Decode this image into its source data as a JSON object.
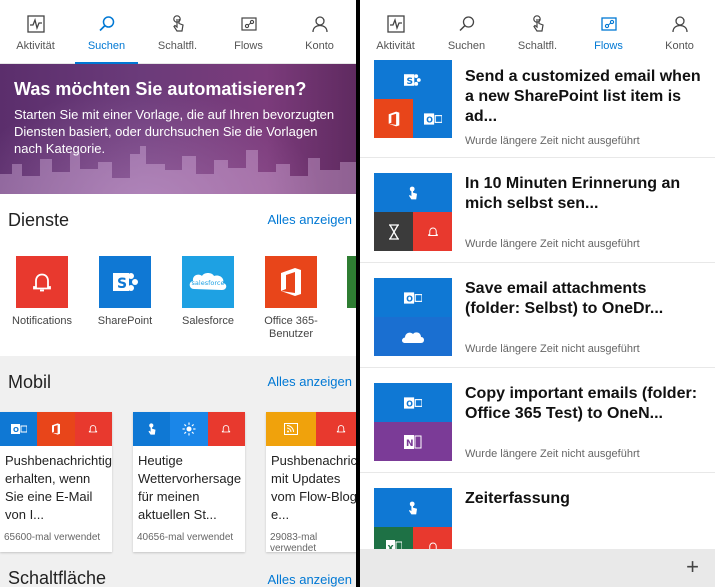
{
  "nav_left": [
    {
      "label": "Aktivität",
      "icon": "activity-icon",
      "active": false
    },
    {
      "label": "Suchen",
      "icon": "search-icon",
      "active": true
    },
    {
      "label": "Schaltfl.",
      "icon": "touch-icon",
      "active": false
    },
    {
      "label": "Flows",
      "icon": "flows-icon",
      "active": false
    },
    {
      "label": "Konto",
      "icon": "account-icon",
      "active": false
    }
  ],
  "nav_right": [
    {
      "label": "Aktivität",
      "icon": "activity-icon",
      "active": false
    },
    {
      "label": "Suchen",
      "icon": "search-icon",
      "active": false
    },
    {
      "label": "Schaltfl.",
      "icon": "touch-icon",
      "active": false
    },
    {
      "label": "Flows",
      "icon": "flows-icon",
      "active": true
    },
    {
      "label": "Konto",
      "icon": "account-icon",
      "active": false
    }
  ],
  "hero": {
    "title": "Was möchten Sie automatisieren?",
    "text": "Starten Sie mit einer Vorlage, die auf Ihren bevorzugten Diensten basiert, oder durchsuchen Sie die Vorlagen nach Kategorie."
  },
  "services": {
    "title": "Dienste",
    "link": "Alles anzeigen",
    "items": [
      {
        "label": "Notifications",
        "color": "#e8392e",
        "icon": "bell-icon"
      },
      {
        "label": "SharePoint",
        "color": "#0f78d4",
        "icon": "sharepoint-icon"
      },
      {
        "label": "Salesforce",
        "color": "#1ea1e3",
        "icon": "salesforce-icon",
        "logo_text": "salesforce"
      },
      {
        "label": "Office 365-Benutzer",
        "color": "#e8451a",
        "icon": "office-icon"
      }
    ]
  },
  "mobil": {
    "title": "Mobil",
    "link": "Alles anzeigen",
    "cards": [
      {
        "title": "Pushbenachrichtigung erhalten, wenn Sie eine E-Mail von I...",
        "usage": "65600-mal verwendet"
      },
      {
        "title": "Heutige Wettervorhersage für meinen aktuellen St...",
        "usage": "40656-mal verwendet"
      },
      {
        "title": "Pushbenachrichtigung mit Updates vom Flow-Blog e...",
        "usage": "29083-mal verwendet"
      }
    ]
  },
  "schalt": {
    "title": "Schaltfläche",
    "link": "Alles anzeigen"
  },
  "flows": [
    {
      "title": "Send a customized email when a new SharePoint list item is ad...",
      "status": "Wurde längere Zeit nicht ausgeführt"
    },
    {
      "title": "In 10 Minuten Erinnerung an mich selbst sen...",
      "status": "Wurde längere Zeit nicht ausgeführt"
    },
    {
      "title": "Save email attachments (folder: Selbst) to OneDr...",
      "status": "Wurde längere Zeit nicht ausgeführt"
    },
    {
      "title": "Copy important emails (folder: Office 365 Test) to OneN...",
      "status": "Wurde längere Zeit nicht ausgeführt"
    },
    {
      "title": "Zeiterfassung",
      "status": ""
    }
  ],
  "add_button": "+",
  "colors": {
    "accent": "#0078d4",
    "outlook": "#0f78d4",
    "office": "#e8451a",
    "notification": "#e8392e",
    "onenote": "#7b3b97",
    "excel": "#1e7145",
    "weather": "#1a86e8",
    "rss": "#f0a20c"
  }
}
